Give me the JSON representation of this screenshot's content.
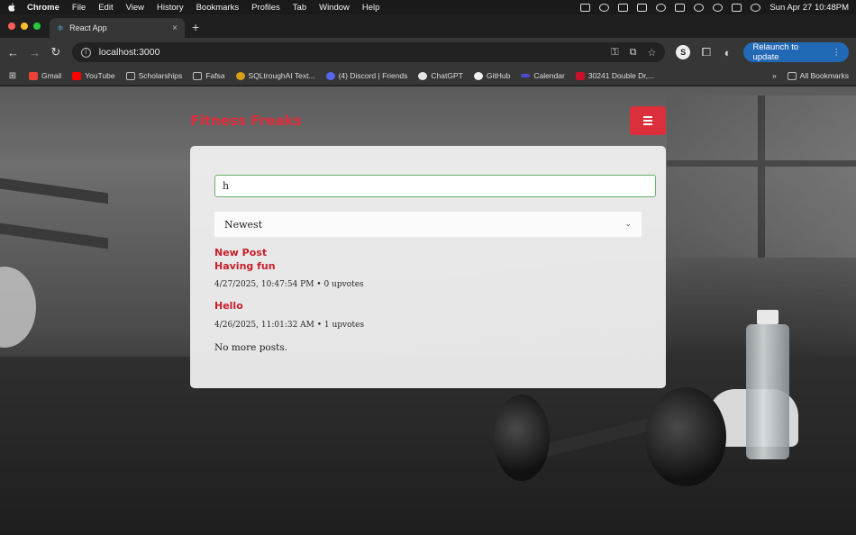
{
  "menubar": {
    "items": [
      "Chrome",
      "File",
      "Edit",
      "View",
      "History",
      "Bookmarks",
      "Profiles",
      "Tab",
      "Window",
      "Help"
    ],
    "datetime": "Sun Apr 27  10:48PM"
  },
  "browser": {
    "tab_title": "React App",
    "url": "localhost:3000",
    "relaunch_label": "Relaunch to update",
    "profile_initial": "S"
  },
  "bookmarks": {
    "items": [
      "Gmail",
      "YouTube",
      "Scholarships",
      "Fafsa",
      "SQLtroughAI Text...",
      "(4) Discord | Friends",
      "ChatGPT",
      "GitHub",
      "Calendar",
      "30241 Double Dr,..."
    ],
    "all_label": "All Bookmarks",
    "overflow": "»"
  },
  "site": {
    "brand": "Fitness Freaks",
    "search": {
      "value": "h",
      "placeholder": ""
    },
    "sort": {
      "selected": "Newest"
    },
    "posts": [
      {
        "title": "New Post",
        "body": "Having fun",
        "meta": "4/27/2025, 10:47:54 PM • 0 upvotes"
      },
      {
        "title": "Hello",
        "meta": "4/26/2025, 11:01:32 AM • 1 upvotes"
      }
    ],
    "end_text": "No more posts."
  },
  "colors": {
    "brand_red": "#dc2f3c",
    "search_border": "#6ab06b",
    "relaunch_blue": "#2269b5"
  }
}
